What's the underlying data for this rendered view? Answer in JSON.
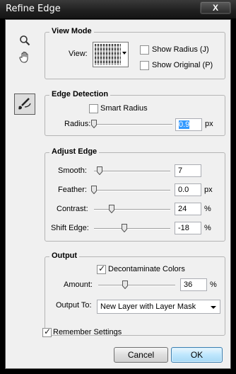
{
  "window": {
    "title": "Refine Edge",
    "close_label": "X"
  },
  "tools": {
    "zoom": "zoom-tool",
    "hand": "hand-tool",
    "refine_radius": "refine-radius-tool"
  },
  "view_mode": {
    "legend": "View Mode",
    "view_label": "View:",
    "show_radius": {
      "label": "Show Radius (J)",
      "checked": false
    },
    "show_original": {
      "label": "Show Original (P)",
      "checked": false
    }
  },
  "edge_detection": {
    "legend": "Edge Detection",
    "smart_radius": {
      "label": "Smart Radius",
      "checked": false
    },
    "radius": {
      "label": "Radius:",
      "value": "0.9",
      "unit": "px",
      "slider_fraction": 0.0
    }
  },
  "adjust_edge": {
    "legend": "Adjust Edge",
    "smooth": {
      "label": "Smooth:",
      "value": "7",
      "unit": "",
      "slider_fraction": 0.07
    },
    "feather": {
      "label": "Feather:",
      "value": "0.0",
      "unit": "px",
      "slider_fraction": 0.0
    },
    "contrast": {
      "label": "Contrast:",
      "value": "24",
      "unit": "%",
      "slider_fraction": 0.24
    },
    "shift_edge": {
      "label": "Shift Edge:",
      "value": "-18",
      "unit": "%",
      "slider_fraction": 0.41
    }
  },
  "output": {
    "legend": "Output",
    "decontaminate": {
      "label": "Decontaminate Colors",
      "checked": true
    },
    "amount": {
      "label": "Amount:",
      "value": "36",
      "unit": "%",
      "slider_fraction": 0.36
    },
    "output_to": {
      "label": "Output To:",
      "selected": "New Layer with Layer Mask"
    }
  },
  "remember": {
    "label": "Remember Settings",
    "checked": true
  },
  "buttons": {
    "cancel": "Cancel",
    "ok": "OK"
  }
}
